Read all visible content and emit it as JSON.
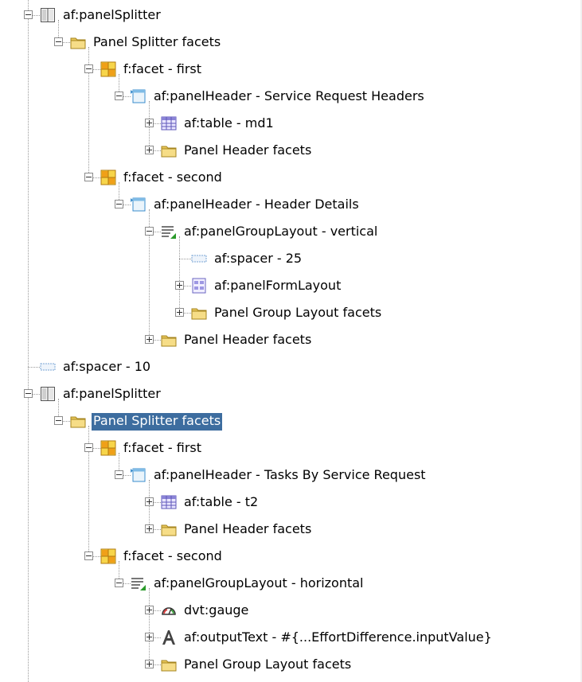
{
  "tree": {
    "nodes": [
      {
        "label": "af:panelSplitter",
        "icon": "panel-splitter-icon",
        "depth": 0,
        "toggle": "minus",
        "selected": false
      },
      {
        "label": "Panel Splitter facets",
        "icon": "folder-icon",
        "depth": 1,
        "toggle": "minus",
        "selected": false
      },
      {
        "label": "f:facet - first",
        "icon": "facet-icon",
        "depth": 2,
        "toggle": "minus",
        "selected": false
      },
      {
        "label": "af:panelHeader - Service Request Headers",
        "icon": "panel-header-icon",
        "depth": 3,
        "toggle": "minus",
        "selected": false
      },
      {
        "label": "af:table - md1",
        "icon": "table-icon",
        "depth": 4,
        "toggle": "plus",
        "selected": false
      },
      {
        "label": "Panel Header facets",
        "icon": "folder-icon",
        "depth": 4,
        "toggle": "plus",
        "selected": false
      },
      {
        "label": "f:facet - second",
        "icon": "facet-icon",
        "depth": 2,
        "toggle": "minus",
        "selected": false
      },
      {
        "label": "af:panelHeader - Header Details",
        "icon": "panel-header-icon",
        "depth": 3,
        "toggle": "minus",
        "selected": false
      },
      {
        "label": "af:panelGroupLayout - vertical",
        "icon": "panel-group-layout-icon",
        "depth": 4,
        "toggle": "minus",
        "selected": false
      },
      {
        "label": "af:spacer - 25",
        "icon": "spacer-icon",
        "depth": 5,
        "toggle": "none",
        "selected": false
      },
      {
        "label": "af:panelFormLayout",
        "icon": "panel-form-layout-icon",
        "depth": 5,
        "toggle": "plus",
        "selected": false
      },
      {
        "label": "Panel Group Layout facets",
        "icon": "folder-icon",
        "depth": 5,
        "toggle": "plus",
        "selected": false
      },
      {
        "label": "Panel Header facets",
        "icon": "folder-icon",
        "depth": 4,
        "toggle": "plus",
        "selected": false
      },
      {
        "label": "af:spacer - 10",
        "icon": "spacer-icon",
        "depth": 0,
        "toggle": "none",
        "selected": false
      },
      {
        "label": "af:panelSplitter",
        "icon": "panel-splitter-icon",
        "depth": 0,
        "toggle": "minus",
        "selected": false
      },
      {
        "label": "Panel Splitter facets",
        "icon": "folder-icon",
        "depth": 1,
        "toggle": "minus",
        "selected": true
      },
      {
        "label": "f:facet - first",
        "icon": "facet-icon",
        "depth": 2,
        "toggle": "minus",
        "selected": false
      },
      {
        "label": "af:panelHeader - Tasks By Service Request",
        "icon": "panel-header-icon",
        "depth": 3,
        "toggle": "minus",
        "selected": false
      },
      {
        "label": "af:table - t2",
        "icon": "table-icon",
        "depth": 4,
        "toggle": "plus",
        "selected": false
      },
      {
        "label": "Panel Header facets",
        "icon": "folder-icon",
        "depth": 4,
        "toggle": "plus",
        "selected": false
      },
      {
        "label": "f:facet - second",
        "icon": "facet-icon",
        "depth": 2,
        "toggle": "minus",
        "selected": false
      },
      {
        "label": "af:panelGroupLayout - horizontal",
        "icon": "panel-group-layout-icon",
        "depth": 3,
        "toggle": "minus",
        "selected": false
      },
      {
        "label": "dvt:gauge",
        "icon": "gauge-icon",
        "depth": 4,
        "toggle": "plus",
        "selected": false
      },
      {
        "label": "af:outputText - #{...EffortDifference.inputValue}",
        "icon": "output-text-icon",
        "depth": 4,
        "toggle": "plus",
        "selected": false
      },
      {
        "label": "Panel Group Layout facets",
        "icon": "folder-icon",
        "depth": 4,
        "toggle": "plus",
        "selected": false
      }
    ]
  },
  "colors": {
    "selection_background": "#3d6d9f",
    "selection_text": "#ffffff",
    "folder": "#e8c65a",
    "facet_orange": "#f0a018",
    "facet_yellow": "#f7d54a",
    "connector": "#9a9a9a"
  }
}
